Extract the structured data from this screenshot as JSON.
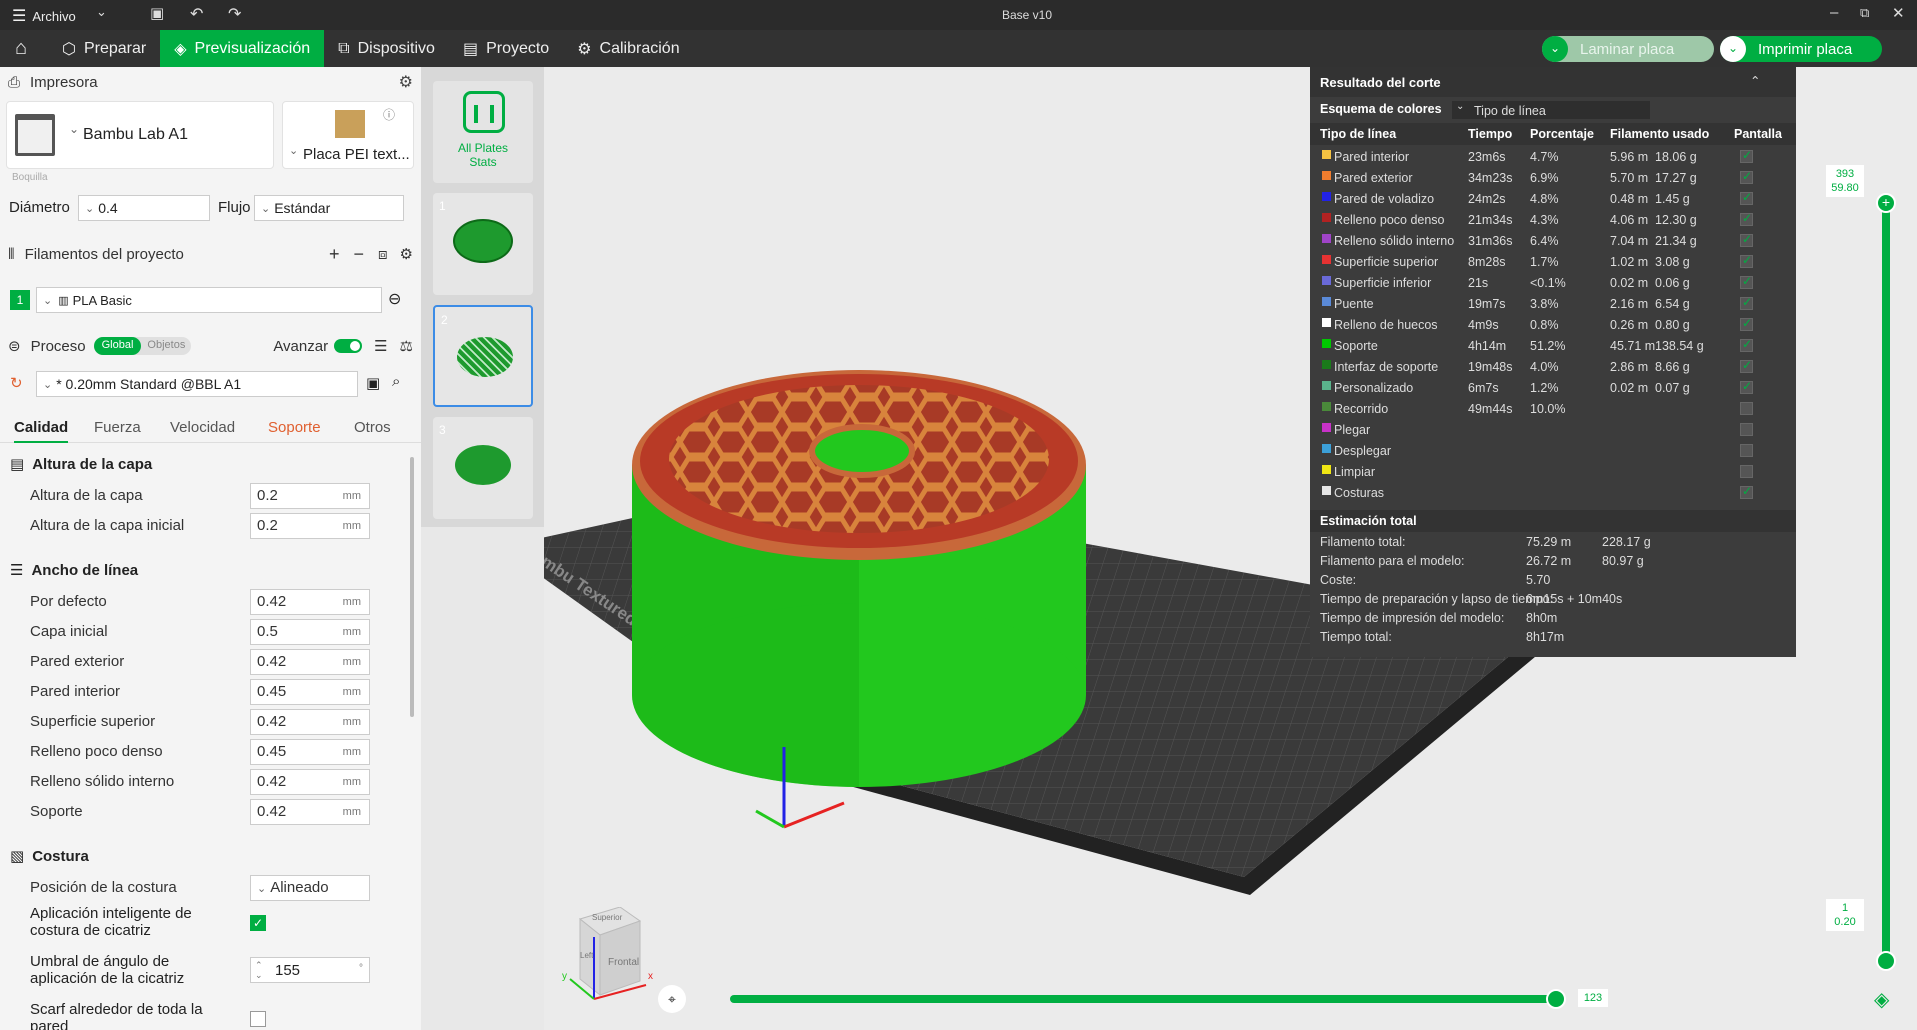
{
  "window": {
    "title": "Base v10",
    "menu_label": "Archivo"
  },
  "nav": {
    "tabs": [
      {
        "label": "Preparar"
      },
      {
        "label": "Previsualización"
      },
      {
        "label": "Dispositivo"
      },
      {
        "label": "Proyecto"
      },
      {
        "label": "Calibración"
      }
    ],
    "slice_button": "Laminar placa",
    "print_button": "Imprimir placa"
  },
  "printer": {
    "section_title": "Impresora",
    "name": "Bambu Lab A1",
    "plate": "Placa PEI text...",
    "nozzle_label": "Boquilla",
    "diameter_label": "Diámetro",
    "diameter": "0.4",
    "flow_label": "Flujo",
    "flow": "Estándar"
  },
  "filaments": {
    "section_title": "Filamentos del proyecto",
    "items": [
      {
        "index": "1",
        "name": "PLA Basic"
      }
    ]
  },
  "process": {
    "section_title": "Proceso",
    "toggle_global": "Global",
    "toggle_objects": "Objetos",
    "advance_label": "Avanzar",
    "profile": "* 0.20mm Standard @BBL A1",
    "tabs": [
      "Calidad",
      "Fuerza",
      "Velocidad",
      "Soporte",
      "Otros"
    ]
  },
  "quality": {
    "layer_height": {
      "title": "Altura de la capa",
      "rows": [
        {
          "label": "Altura de la capa",
          "value": "0.2",
          "unit": "mm"
        },
        {
          "label": "Altura de la capa inicial",
          "value": "0.2",
          "unit": "mm"
        }
      ]
    },
    "line_width": {
      "title": "Ancho de línea",
      "rows": [
        {
          "label": "Por defecto",
          "value": "0.42",
          "unit": "mm"
        },
        {
          "label": "Capa inicial",
          "value": "0.5",
          "unit": "mm"
        },
        {
          "label": "Pared exterior",
          "value": "0.42",
          "unit": "mm"
        },
        {
          "label": "Pared interior",
          "value": "0.45",
          "unit": "mm"
        },
        {
          "label": "Superficie superior",
          "value": "0.42",
          "unit": "mm"
        },
        {
          "label": "Relleno poco denso",
          "value": "0.45",
          "unit": "mm"
        },
        {
          "label": "Relleno sólido interno",
          "value": "0.42",
          "unit": "mm"
        },
        {
          "label": "Soporte",
          "value": "0.42",
          "unit": "mm"
        }
      ]
    },
    "seam": {
      "title": "Costura",
      "position_label": "Posición de la costura",
      "position": "Alineado",
      "smart_label_1": "Aplicación inteligente de",
      "smart_label_2": "costura de cicatriz",
      "angle_label_1": "Umbral de ángulo de",
      "angle_label_2": "aplicación de la cicatriz",
      "angle": "155",
      "angle_unit": "°",
      "scarf_label_1": "Scarf alrededor de toda la",
      "scarf_label_2": "pared"
    }
  },
  "plates": {
    "all_label_1": "All Plates",
    "all_label_2": "Stats",
    "items": [
      "1",
      "2",
      "3"
    ]
  },
  "result": {
    "title": "Resultado del corte",
    "scheme_label": "Esquema de colores",
    "scheme": "Tipo de línea",
    "headers": [
      "Tipo de línea",
      "Tiempo",
      "Porcentaje",
      "Filamento usado",
      "Pantalla"
    ],
    "rows": [
      {
        "name": "Pared interior",
        "time": "23m6s",
        "pct": "4.7%",
        "len": "5.96 m",
        "g": "18.06 g",
        "color": "#f5c242",
        "on": true
      },
      {
        "name": "Pared exterior",
        "time": "34m23s",
        "pct": "6.9%",
        "len": "5.70 m",
        "g": "17.27 g",
        "color": "#f07d2e",
        "on": true
      },
      {
        "name": "Pared de voladizo",
        "time": "24m2s",
        "pct": "4.8%",
        "len": "0.48 m",
        "g": "1.45 g",
        "color": "#2222e6",
        "on": true
      },
      {
        "name": "Relleno poco denso",
        "time": "21m34s",
        "pct": "4.3%",
        "len": "4.06 m",
        "g": "12.30 g",
        "color": "#b22222",
        "on": true
      },
      {
        "name": "Relleno sólido interno",
        "time": "31m36s",
        "pct": "6.4%",
        "len": "7.04 m",
        "g": "21.34 g",
        "color": "#a044c8",
        "on": true
      },
      {
        "name": "Superficie superior",
        "time": "8m28s",
        "pct": "1.7%",
        "len": "1.02 m",
        "g": "3.08 g",
        "color": "#e63232",
        "on": true
      },
      {
        "name": "Superficie inferior",
        "time": "21s",
        "pct": "<0.1%",
        "len": "0.02 m",
        "g": "0.06 g",
        "color": "#6a6ad8",
        "on": true
      },
      {
        "name": "Puente",
        "time": "19m7s",
        "pct": "3.8%",
        "len": "2.16 m",
        "g": "6.54 g",
        "color": "#5a8ad8",
        "on": true
      },
      {
        "name": "Relleno de huecos",
        "time": "4m9s",
        "pct": "0.8%",
        "len": "0.26 m",
        "g": "0.80 g",
        "color": "#ffffff",
        "on": true
      },
      {
        "name": "Soporte",
        "time": "4h14m",
        "pct": "51.2%",
        "len": "45.71 m",
        "g": "138.54 g",
        "color": "#00c800",
        "on": true
      },
      {
        "name": "Interfaz de soporte",
        "time": "19m48s",
        "pct": "4.0%",
        "len": "2.86 m",
        "g": "8.66 g",
        "color": "#1a7a1a",
        "on": true
      },
      {
        "name": "Personalizado",
        "time": "6m7s",
        "pct": "1.2%",
        "len": "0.02 m",
        "g": "0.07 g",
        "color": "#5ab48c",
        "on": true
      },
      {
        "name": "Recorrido",
        "time": "49m44s",
        "pct": "10.0%",
        "len": "",
        "g": "",
        "color": "#4a8a3a",
        "on": false
      },
      {
        "name": "Plegar",
        "time": "",
        "pct": "",
        "len": "",
        "g": "",
        "color": "#c832c8",
        "on": false
      },
      {
        "name": "Desplegar",
        "time": "",
        "pct": "",
        "len": "",
        "g": "",
        "color": "#3ca0d8",
        "on": false
      },
      {
        "name": "Limpiar",
        "time": "",
        "pct": "",
        "len": "",
        "g": "",
        "color": "#f0e614",
        "on": false
      },
      {
        "name": "Costuras",
        "time": "",
        "pct": "",
        "len": "",
        "g": "",
        "color": "#e6e6e6",
        "on": true
      }
    ],
    "total_title": "Estimación total",
    "totals": [
      {
        "label": "Filamento total:",
        "v1": "75.29 m",
        "v2": "228.17 g"
      },
      {
        "label": "Filamento para el modelo:",
        "v1": "26.72 m",
        "v2": "80.97 g"
      },
      {
        "label": "Coste:",
        "v1": "5.70",
        "v2": ""
      },
      {
        "label": "Tiempo de preparación y lapso de tiempo:",
        "v1": "6m15s + 10m40s",
        "v2": ""
      },
      {
        "label": "Tiempo de impresión del modelo:",
        "v1": "8h0m",
        "v2": ""
      },
      {
        "label": "Tiempo total:",
        "v1": "8h17m",
        "v2": ""
      }
    ]
  },
  "layer_slider": {
    "top_layer": "393",
    "top_height": "59.80",
    "bottom_layer": "1",
    "bottom_height": "0.20"
  },
  "move_slider": {
    "value": "123"
  },
  "bed": {
    "label": "Bambu Textured PEI Plate"
  },
  "view_cube": {
    "top": "Superior",
    "left": "Left",
    "front": "Frontal",
    "axis_y": "y",
    "axis_x": "x"
  },
  "colors": {
    "accent": "#00ae42",
    "support": "#00c800",
    "wall": "#f07d2e",
    "infill": "#b22222"
  }
}
